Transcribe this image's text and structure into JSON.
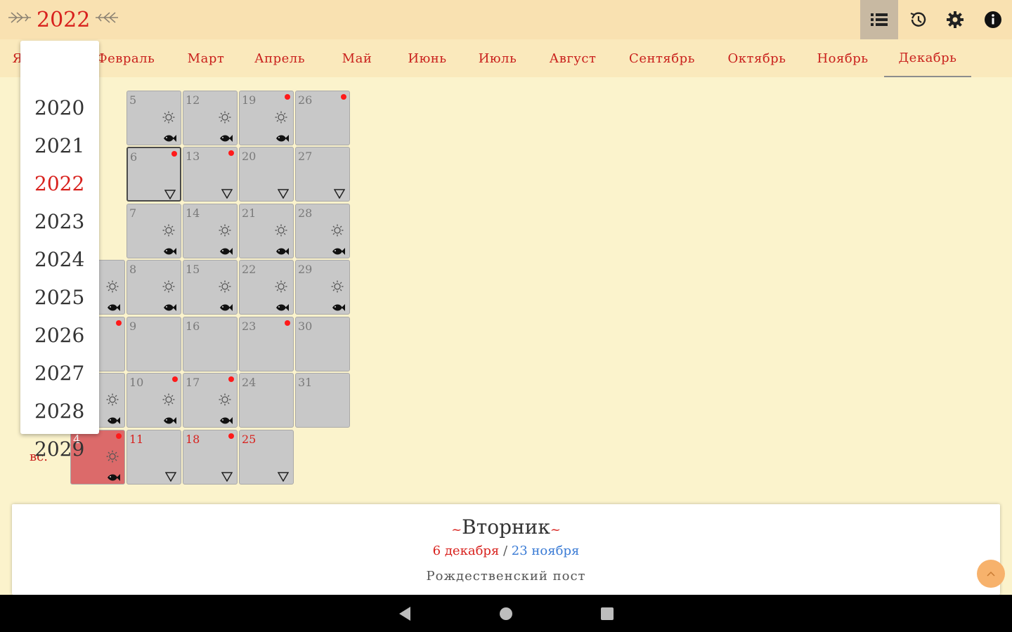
{
  "header": {
    "year": "2022",
    "icons": [
      "list-icon",
      "history-icon",
      "settings-icon",
      "info-icon"
    ]
  },
  "months": [
    {
      "label": "Я"
    },
    {
      "label": "Февраль"
    },
    {
      "label": "Март"
    },
    {
      "label": "Апрель"
    },
    {
      "label": "Май"
    },
    {
      "label": "Июнь"
    },
    {
      "label": "Июль"
    },
    {
      "label": "Август"
    },
    {
      "label": "Сентябрь"
    },
    {
      "label": "Октябрь"
    },
    {
      "label": "Ноябрь"
    },
    {
      "label": "Декабрь",
      "active": true
    }
  ],
  "year_dropdown": {
    "years": [
      "2020",
      "2021",
      "2022",
      "2023",
      "2024",
      "2025",
      "2026",
      "2027",
      "2028",
      "2029"
    ],
    "selected": "2022"
  },
  "calendar": {
    "sunday_label": "вс.",
    "days": [
      {
        "day": "5",
        "dot": false,
        "sun": true,
        "fish": true
      },
      {
        "day": "12",
        "dot": false,
        "sun": true,
        "fish": true
      },
      {
        "day": "19",
        "dot": true,
        "sun": true,
        "fish": true
      },
      {
        "day": "26",
        "dot": true
      },
      {
        "day": "6",
        "dot": true,
        "tri": true,
        "today": true
      },
      {
        "day": "13",
        "dot": true,
        "tri": true
      },
      {
        "day": "20",
        "tri": true
      },
      {
        "day": "27",
        "tri": true
      },
      {
        "day": "7",
        "sun": true,
        "fish": true
      },
      {
        "day": "14",
        "sun": true,
        "fish": true
      },
      {
        "day": "21",
        "sun": true,
        "fish": true
      },
      {
        "day": "28",
        "sun": true,
        "fish": true
      },
      {
        "day": "",
        "sun": true,
        "fish": true
      },
      {
        "day": "8",
        "sun": true,
        "fish": true
      },
      {
        "day": "15",
        "sun": true,
        "fish": true
      },
      {
        "day": "22",
        "sun": true,
        "fish": true
      },
      {
        "day": "29",
        "sun": true,
        "fish": true
      },
      {
        "day": "",
        "dot": true
      },
      {
        "day": "9"
      },
      {
        "day": "16"
      },
      {
        "day": "23",
        "dot": true
      },
      {
        "day": "30"
      },
      {
        "day": "",
        "sun": true,
        "fish": true
      },
      {
        "day": "10",
        "dot": true,
        "sun": true,
        "fish": true
      },
      {
        "day": "17",
        "dot": true,
        "sun": true,
        "fish": true
      },
      {
        "day": "24"
      },
      {
        "day": "31"
      },
      {
        "day": "4",
        "dot": true,
        "sun": true,
        "fish": true,
        "sunday": true,
        "sunrow": true
      },
      {
        "day": "11",
        "tri": true,
        "sunrow": true
      },
      {
        "day": "18",
        "dot": true,
        "tri": true,
        "sunrow": true
      },
      {
        "day": "25",
        "tri": true,
        "sunrow": true
      }
    ]
  },
  "day_panel": {
    "weekday": "Вторник",
    "date_new": "6 декабря",
    "separator": " / ",
    "date_old": "23 ноября",
    "fast": "Рождественский пост"
  },
  "colors": {
    "accent_red": "#d8211d",
    "background": "#fbf3cc",
    "topbar": "#f9e1b1",
    "cell": "#c8c8c8",
    "sunday_cell": "#dc6a6a",
    "old_style_blue": "#3a7bd5"
  },
  "navigation": {
    "icons": [
      "back-icon",
      "home-icon",
      "recents-icon"
    ]
  }
}
